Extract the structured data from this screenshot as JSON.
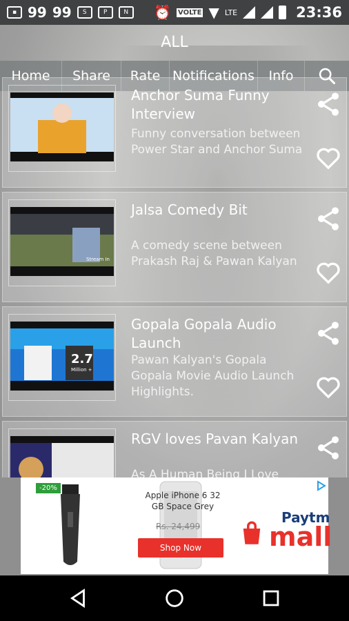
{
  "status_bar": {
    "left_numbers": [
      "99",
      "99"
    ],
    "volte_label": "VOLTE",
    "network_label": "LTE",
    "time": "23:36"
  },
  "app": {
    "title": "ALL",
    "menu": [
      "Home",
      "Share",
      "Rate",
      "Notifications",
      "Info"
    ],
    "search_icon": "search-icon"
  },
  "videos": [
    {
      "title": "Anchor Suma Funny Interview",
      "description": "Funny conversation between Power Star and Anchor Suma",
      "thumb_colors": [
        "#c9dff2",
        "#f2d5c2",
        "#e9a32c"
      ]
    },
    {
      "title": "Jalsa Comedy Bit",
      "description": "A comedy scene between Prakash Raj & Pawan Kalyan",
      "thumb_colors": [
        "#6a7a4a",
        "#8aa0c0",
        "#3a3d44"
      ],
      "thumb_watermark": "Stream In"
    },
    {
      "title": "Gopala Gopala Audio Launch",
      "description": "Pawan Kalyan's Gopala Gopala Movie Audio Launch Highlights.",
      "thumb_colors": [
        "#1e76d2",
        "#2aa0e8",
        "#f0d000"
      ],
      "thumb_badge": "2.7",
      "thumb_badge_sub": "Million +"
    },
    {
      "title": "RGV loves Pavan Kalyan",
      "description": "As A Human Being I Love",
      "thumb_colors": [
        "#2a2a6a",
        "#e8e8e8",
        "#d4a05a"
      ]
    }
  ],
  "ad": {
    "discount": "-20%",
    "product": "Apple iPhone 6 32 GB Space Grey",
    "price": "Rs. 24,499",
    "cta": "Shop Now",
    "brand_top": "Paytm",
    "brand_main": "mall"
  },
  "nav": [
    "back-icon",
    "home-icon",
    "recents-icon"
  ]
}
